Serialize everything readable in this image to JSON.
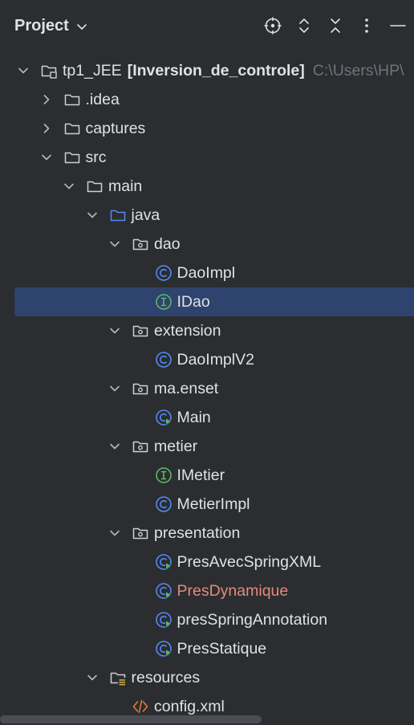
{
  "header": {
    "title": "Project",
    "icons": [
      "locate-icon",
      "expand-all-icon",
      "collapse-all-icon",
      "more-options-icon",
      "hide-icon"
    ]
  },
  "tree": [
    {
      "indent": 0,
      "chevron": "down",
      "icon": "project-folder",
      "label": "tp1_JEE",
      "bold_label": "[Inversion_de_controle]",
      "path": "C:\\Users\\HP\\"
    },
    {
      "indent": 1,
      "chevron": "right",
      "icon": "folder",
      "label": ".idea"
    },
    {
      "indent": 1,
      "chevron": "right",
      "icon": "folder",
      "label": "captures"
    },
    {
      "indent": 1,
      "chevron": "down",
      "icon": "folder",
      "label": "src"
    },
    {
      "indent": 2,
      "chevron": "down",
      "icon": "folder",
      "label": "main"
    },
    {
      "indent": 3,
      "chevron": "down",
      "icon": "source-folder",
      "label": "java"
    },
    {
      "indent": 4,
      "chevron": "down",
      "icon": "package",
      "label": "dao"
    },
    {
      "indent": 5,
      "chevron": "none",
      "icon": "class",
      "label": "DaoImpl"
    },
    {
      "indent": 5,
      "chevron": "none",
      "icon": "interface",
      "label": "IDao",
      "selected": true
    },
    {
      "indent": 4,
      "chevron": "down",
      "icon": "package",
      "label": "extension"
    },
    {
      "indent": 5,
      "chevron": "none",
      "icon": "class",
      "label": "DaoImplV2"
    },
    {
      "indent": 4,
      "chevron": "down",
      "icon": "package",
      "label": "ma.enset"
    },
    {
      "indent": 5,
      "chevron": "none",
      "icon": "runnable-class",
      "label": "Main"
    },
    {
      "indent": 4,
      "chevron": "down",
      "icon": "package",
      "label": "metier"
    },
    {
      "indent": 5,
      "chevron": "none",
      "icon": "interface",
      "label": "IMetier"
    },
    {
      "indent": 5,
      "chevron": "none",
      "icon": "class",
      "label": "MetierImpl"
    },
    {
      "indent": 4,
      "chevron": "down",
      "icon": "package",
      "label": "presentation"
    },
    {
      "indent": 5,
      "chevron": "none",
      "icon": "runnable-class",
      "label": "PresAvecSpringXML"
    },
    {
      "indent": 5,
      "chevron": "none",
      "icon": "runnable-class",
      "label": "PresDynamique",
      "modified": true
    },
    {
      "indent": 5,
      "chevron": "none",
      "icon": "runnable-class",
      "label": "presSpringAnnotation"
    },
    {
      "indent": 5,
      "chevron": "none",
      "icon": "runnable-class",
      "label": "PresStatique"
    },
    {
      "indent": 3,
      "chevron": "down",
      "icon": "resources-folder",
      "label": "resources"
    },
    {
      "indent": 4,
      "chevron": "none",
      "icon": "xml-file",
      "label": "config.xml"
    }
  ],
  "colors": {
    "background": "#2b2d30",
    "selection": "#2e436e",
    "text": "#dfe1e5",
    "muted": "#6f737a",
    "modified": "#e58a7c",
    "class_blue": "#548af7",
    "interface_green": "#5fb865",
    "xml_orange": "#e0773f"
  }
}
